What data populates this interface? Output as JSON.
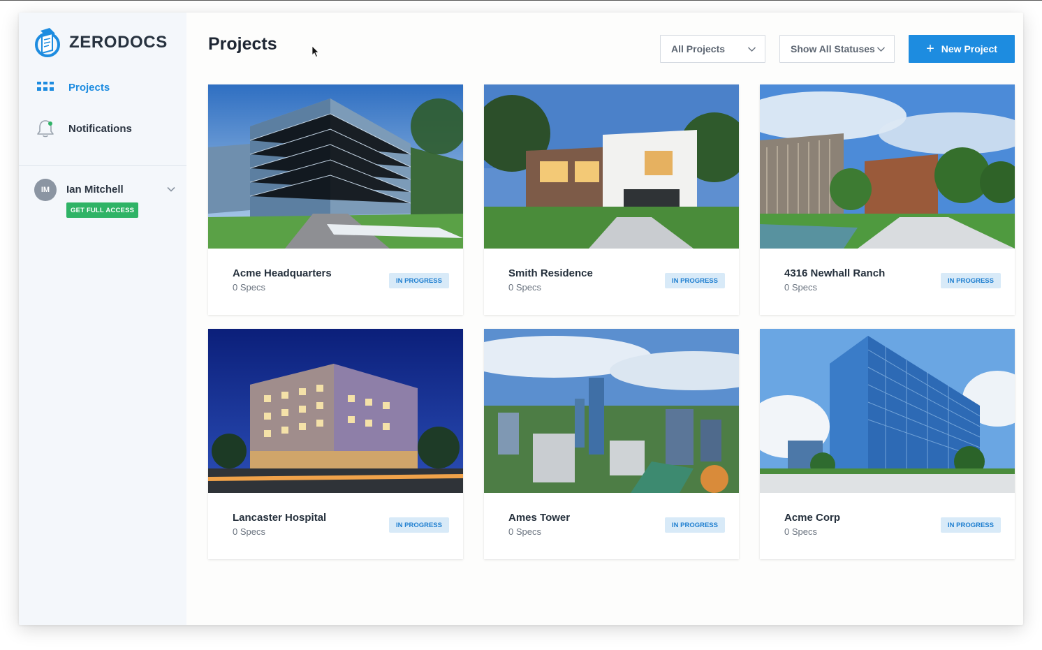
{
  "app": {
    "name": "ZERODOCS"
  },
  "sidebar": {
    "items": [
      {
        "label": "Projects",
        "icon": "grid-icon",
        "active": true
      },
      {
        "label": "Notifications",
        "icon": "bell-icon",
        "active": false
      }
    ],
    "user": {
      "initials": "IM",
      "name": "Ian Mitchell",
      "access_label": "GET FULL ACCESS"
    }
  },
  "main": {
    "title": "Projects",
    "filters": {
      "projects": "All Projects",
      "statuses": "Show All Statuses"
    },
    "new_project_label": "New Project"
  },
  "projects": [
    {
      "name": "Acme Headquarters",
      "specs": "0 Specs",
      "status": "IN PROGRESS"
    },
    {
      "name": "Smith Residence",
      "specs": "0 Specs",
      "status": "IN PROGRESS"
    },
    {
      "name": "4316 Newhall Ranch",
      "specs": "0 Specs",
      "status": "IN PROGRESS"
    },
    {
      "name": "Lancaster Hospital",
      "specs": "0 Specs",
      "status": "IN PROGRESS"
    },
    {
      "name": "Ames Tower",
      "specs": "0 Specs",
      "status": "IN PROGRESS"
    },
    {
      "name": "Acme Corp",
      "specs": "0 Specs",
      "status": "IN PROGRESS"
    }
  ],
  "colors": {
    "accent": "#1d8ce0",
    "success": "#2fb366",
    "badge_bg": "#d8eaf8",
    "sidebar_bg": "#f4f7fb"
  }
}
